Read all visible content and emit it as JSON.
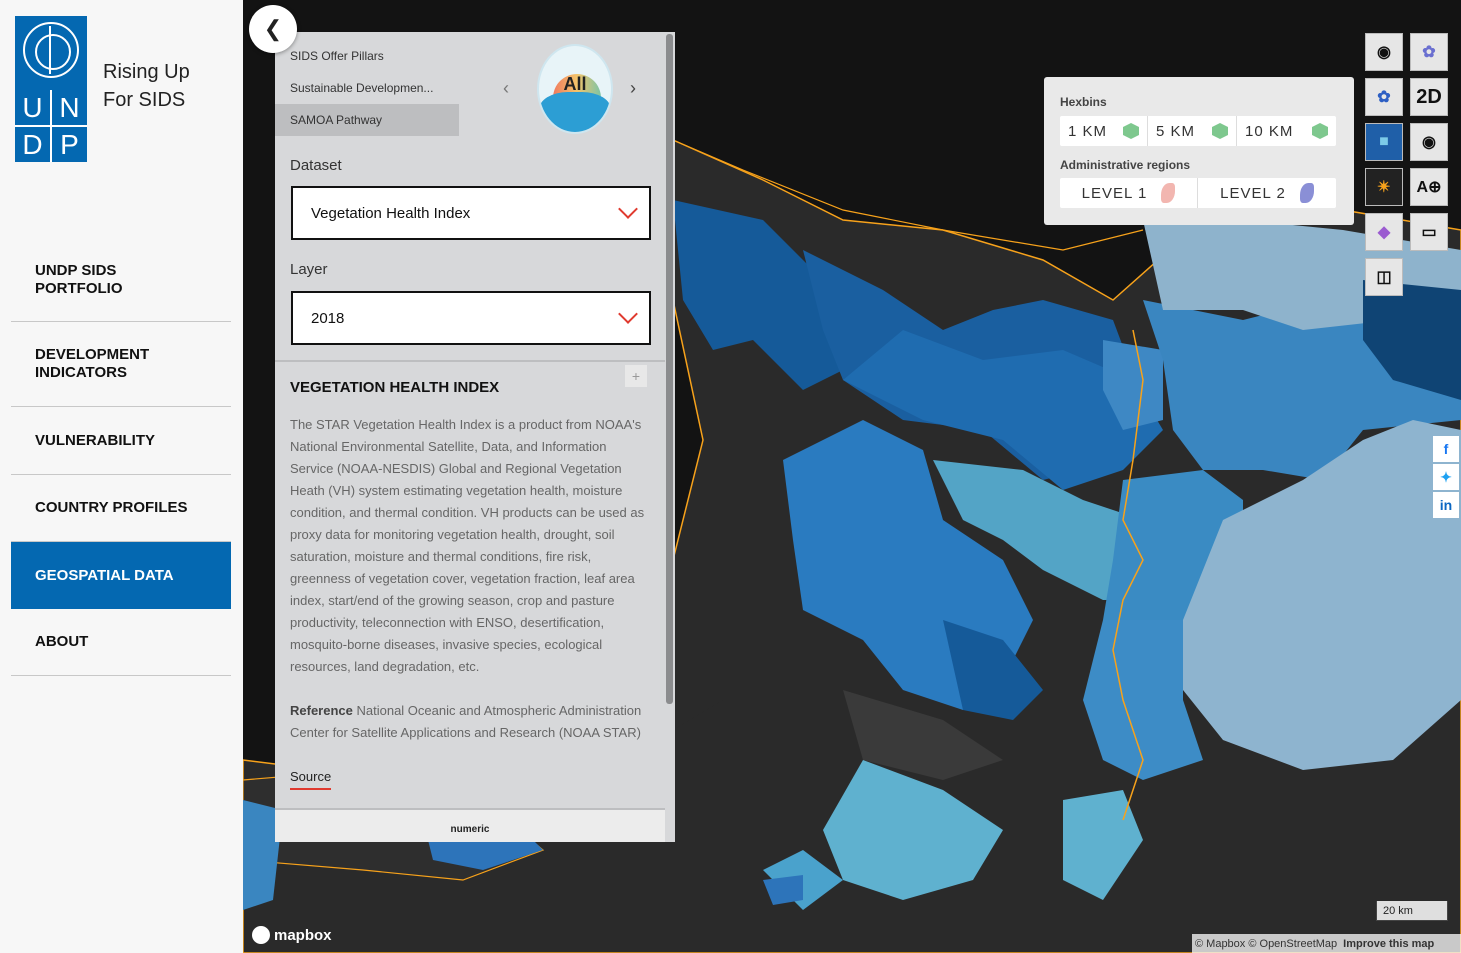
{
  "brand": {
    "line1": "Rising Up",
    "line2": "For SIDS",
    "letters": [
      "U",
      "N",
      "D",
      "P"
    ]
  },
  "nav": [
    {
      "label": "UNDP SIDS PORTFOLIO"
    },
    {
      "label": "DEVELOPMENT INDICATORS"
    },
    {
      "label": "VULNERABILITY"
    },
    {
      "label": "COUNTRY PROFILES"
    },
    {
      "label": "GEOSPATIAL DATA",
      "active": true
    },
    {
      "label": "ABOUT"
    }
  ],
  "panel": {
    "pillars": [
      "SIDS Offer Pillars",
      "Sustainable Developmen...",
      "SAMOA Pathway"
    ],
    "badge": "All",
    "dataset_label": "Dataset",
    "dataset_value": "Vegetation Health Index",
    "layer_label": "Layer",
    "layer_value": "2018",
    "title": "VEGETATION HEALTH INDEX",
    "description": "The STAR Vegetation Health Index is a product from NOAA's National Environmental Satellite, Data, and Information Service (NOAA-NESDIS) Global and Regional Vegetation Heath (VH) system estimating vegetation health, moisture condition, and thermal condition. VH products can be used as proxy data for monitoring vegetation health, drought, soil saturation, moisture and thermal conditions, fire risk, greenness of vegetation cover, vegetation fraction, leaf area index, start/end of the growing season, crop and pasture productivity, teleconnection with ENSO, desertification, mosquito-borne diseases, invasive species, ecological resources, land degradation, etc.",
    "reference_label": "Reference",
    "reference_text": "National Oceanic and Atmospheric Administration Center for Satellite Applications and Research (NOAA STAR)",
    "source_label": "Source",
    "legend_label": "numeric"
  },
  "resolution": {
    "hexbins_label": "Hexbins",
    "hexbins": [
      "1 KM",
      "5 KM",
      "10 KM"
    ],
    "admin_label": "Administrative regions",
    "admin": [
      "LEVEL 1",
      "LEVEL 2"
    ]
  },
  "tools": {
    "mode_2d": "2D"
  },
  "map": {
    "scale": "20 km",
    "logo": "mapbox",
    "attribution": "© Mapbox © OpenStreetMap",
    "improve": "Improve this map"
  },
  "colors": {
    "accent": "#0468b1",
    "chevron": "#e03a2f",
    "border": "#f7a21b"
  }
}
